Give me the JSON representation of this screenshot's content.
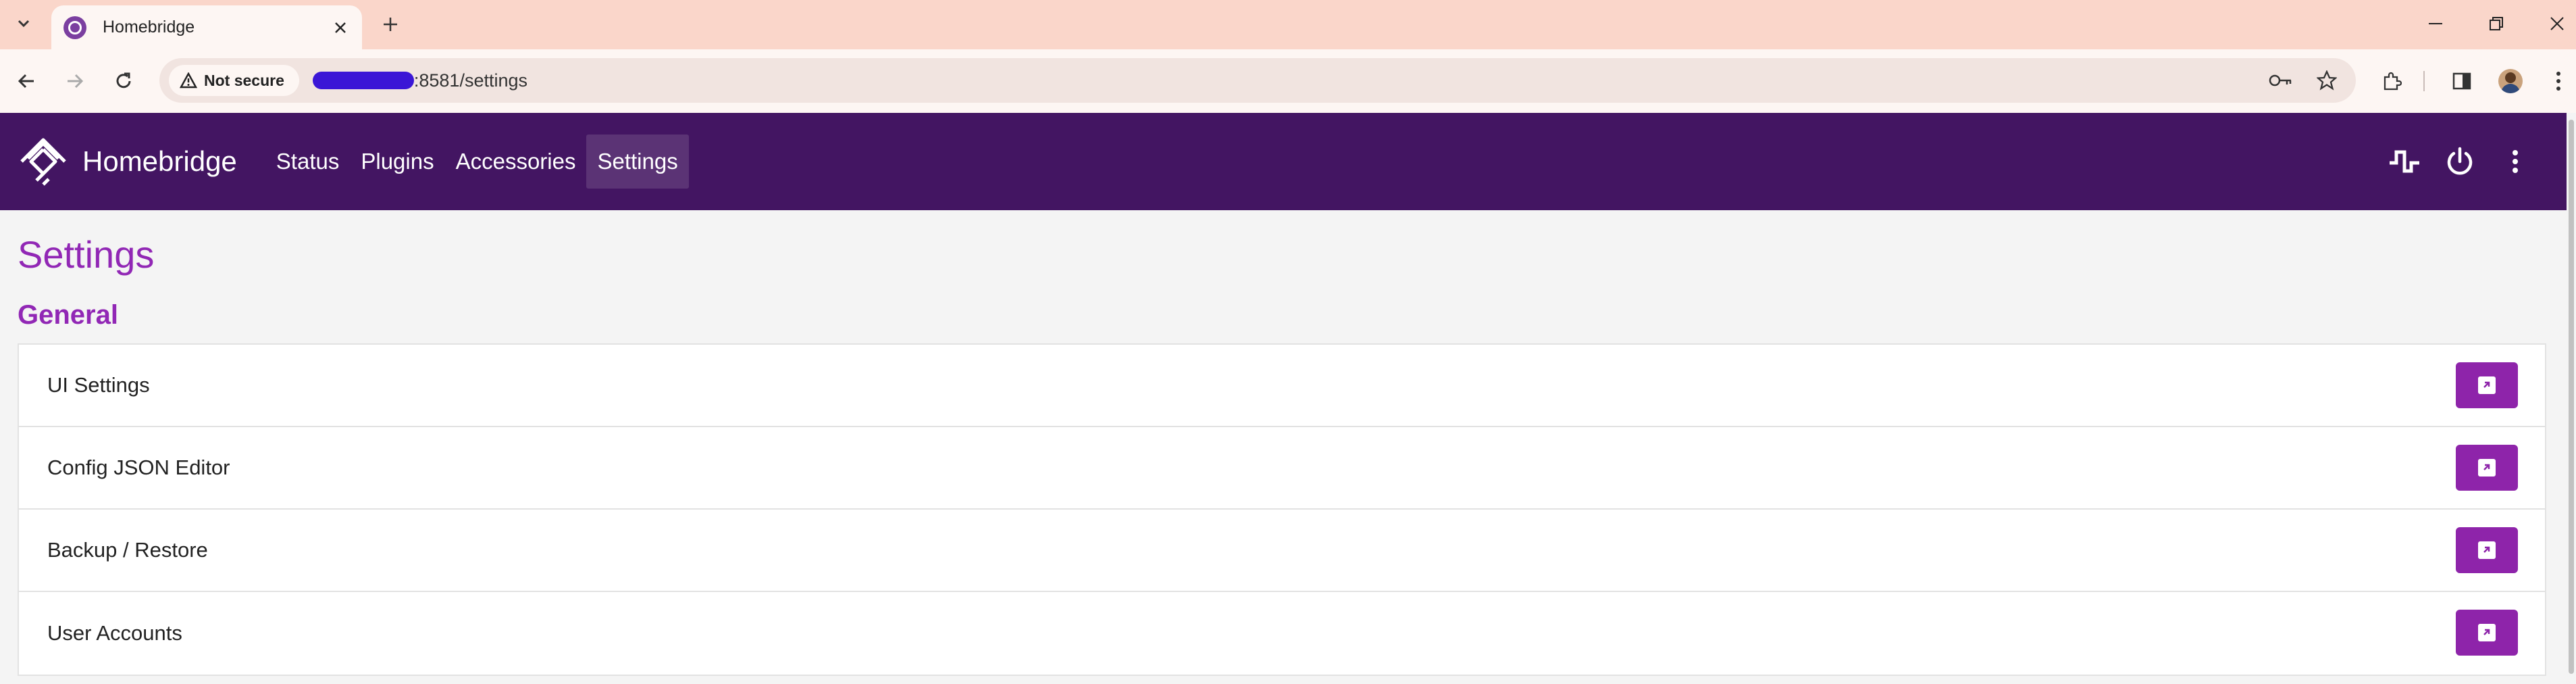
{
  "browser": {
    "tab_title": "Homebridge",
    "security_label": "Not secure",
    "url_text": ":8581/settings"
  },
  "app": {
    "brand_name": "Homebridge",
    "nav": [
      {
        "label": "Status"
      },
      {
        "label": "Plugins"
      },
      {
        "label": "Accessories"
      },
      {
        "label": "Settings",
        "active": true
      }
    ]
  },
  "main": {
    "page_title": "Settings",
    "section_title": "General",
    "items": [
      {
        "label": "UI Settings"
      },
      {
        "label": "Config JSON Editor"
      },
      {
        "label": "Backup / Restore"
      },
      {
        "label": "User Accounts"
      }
    ]
  },
  "colors": {
    "tabbar": "#fad6ca",
    "appbar": "#431562",
    "accent": "#9127b5",
    "button": "#8e24aa"
  },
  "icons": [
    "chevron-down-icon",
    "close-icon",
    "plus-icon",
    "minimize-icon",
    "restore-icon",
    "back-arrow-icon",
    "forward-arrow-icon",
    "reload-icon",
    "warning-icon",
    "key-icon",
    "star-icon",
    "extensions-icon",
    "side-panel-icon",
    "kebab-menu-icon",
    "homebridge-logo",
    "pulse-icon",
    "power-icon",
    "open-icon"
  ]
}
